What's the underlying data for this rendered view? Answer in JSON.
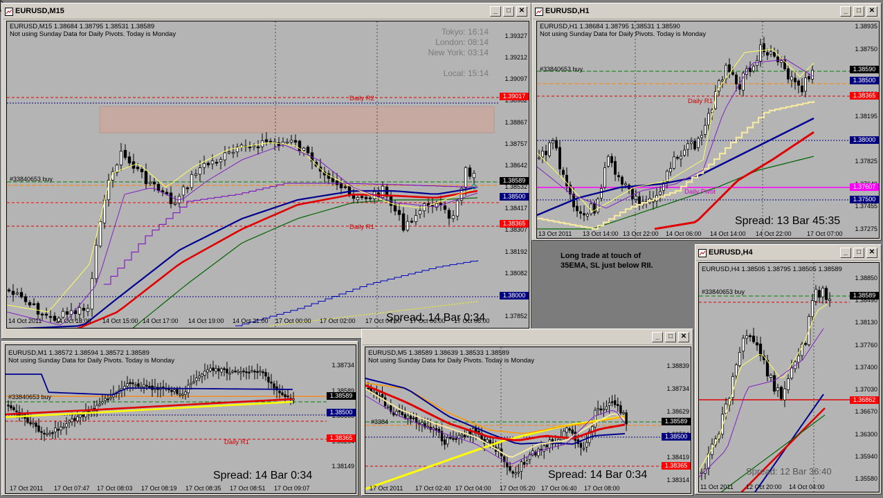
{
  "windows": {
    "m15": {
      "title": "EURUSD,M15",
      "ohlc": "EURUSD,M15  1.38684 1.38795 1.38531 1.38589",
      "note": "Not using Sunday Data for Daily Pivots.  Today is Monday",
      "clocks": [
        "Tokyo: 16:14",
        "London: 08:14",
        "New York: 03:14",
        "Local: 15:14"
      ],
      "price_ticks": [
        "1.39327",
        "1.39212",
        "1.39097",
        "1.38982",
        "1.38867",
        "1.38757",
        "1.38642",
        "1.38532",
        "1.38417",
        "1.38307",
        "1.38192",
        "1.38082",
        "1.37967",
        "1.37852"
      ],
      "tags": [
        {
          "value": "1.39017",
          "color": "#ff0000"
        },
        {
          "value": "1.38589",
          "color": "#000000"
        },
        {
          "value": "1.38500",
          "color": "#000080"
        },
        {
          "value": "1.38365",
          "color": "#ff0000"
        },
        {
          "value": "1.38000",
          "color": "#000080"
        }
      ],
      "time_labels": [
        "14 Oct 2011",
        "14 Oct 13:00",
        "14 Oct 15:00",
        "14 Oct 17:00",
        "14 Oct 19:00",
        "14 Oct 21:00",
        "17 Oct 00:00",
        "17 Oct 02:00",
        "17 Oct 04:00",
        "17 Oct 06:00",
        "17 Oct 08:00"
      ],
      "levels": [
        "Daily R2",
        "Daily R1"
      ],
      "trade_label": "#33840653 buy",
      "spread": "Spread: 14  Bar 0:34"
    },
    "h1": {
      "title": "EURUSD,H1",
      "ohlc": "EURUSD,H1  1.38684 1.38795 1.38531 1.38590",
      "note": "Not using Sunday Data for Daily Pivots.  Today is Monday",
      "price_ticks": [
        "1.38935",
        "1.38750",
        "1.38565",
        "1.38380",
        "1.38195",
        "1.38010",
        "1.37825",
        "1.37640",
        "1.37455",
        "1.37275"
      ],
      "tags": [
        {
          "value": "1.38590",
          "color": "#000000"
        },
        {
          "value": "1.38500",
          "color": "#000080"
        },
        {
          "value": "1.38365",
          "color": "#ff0000"
        },
        {
          "value": "1.38000",
          "color": "#000080"
        },
        {
          "value": "1.37607",
          "color": "#ff00ff"
        },
        {
          "value": "1.37500",
          "color": "#000080"
        }
      ],
      "time_labels": [
        "13 Oct 2011",
        "13 Oct 14:00",
        "13 Oct 22:00",
        "14 Oct 06:00",
        "14 Oct 14:00",
        "14 Oct 22:00",
        "17 Oct 07:00"
      ],
      "levels": [
        "Daily R1",
        "Daily Pivot"
      ],
      "trade_label": "#33840653 buy",
      "spread": "Spread: 13 Bar  45:35"
    },
    "h4": {
      "title": "EURUSD,H4",
      "ohlc": "EURUSD,H4  1.38505 1.38795 1.38505 1.38589",
      "price_ticks": [
        "1.38850",
        "1.38490",
        "1.38130",
        "1.37760",
        "1.37400",
        "1.37030",
        "1.36670",
        "1.36300",
        "1.35940",
        "1.35580"
      ],
      "tags": [
        {
          "value": "1.38589",
          "color": "#000000"
        },
        {
          "value": "1.36862",
          "color": "#ff0000"
        }
      ],
      "time_labels": [
        "11 Oct 2011",
        "12 Oct 20:00",
        "14 Oct 04:00"
      ],
      "trade_label": "#33840653 buy",
      "spread": "Spread: 12 Bar  36:40"
    },
    "m1": {
      "title": "",
      "ohlc": "EURUSD,M1  1.38572 1.38594 1.38572 1.38589",
      "note": "Not using Sunday Data for Daily Pivots.  Today is Monday",
      "price_ticks": [
        "1.38734",
        "1.38589",
        "1.38365",
        "1.38264",
        "1.38149"
      ],
      "tags": [
        {
          "value": "1.38589",
          "color": "#000000"
        },
        {
          "value": "1.38500",
          "color": "#000080"
        },
        {
          "value": "1.38365",
          "color": "#ff0000"
        }
      ],
      "time_labels": [
        "17 Oct 2011",
        "17 Oct 07:47",
        "17 Oct 08:03",
        "17 Oct 08:19",
        "17 Oct 08:35",
        "17 Oct 08:51",
        "17 Oct 09:07"
      ],
      "levels": [
        "Daily R1"
      ],
      "trade_label": "#33840653 buy",
      "spread": "Spread: 14  Bar 0:34"
    },
    "m5": {
      "title": "",
      "ohlc": "EURUSD,M5  1.38589 1.38639 1.38533 1.38589",
      "note": "Not using Sunday Data for Daily Pivots.  Today is Monday",
      "price_ticks": [
        "1.38839",
        "1.38734",
        "1.38629",
        "1.38524",
        "1.38419",
        "1.38314"
      ],
      "tags": [
        {
          "value": "1.38589",
          "color": "#000000"
        },
        {
          "value": "1.38500",
          "color": "#000080"
        },
        {
          "value": "1.38365",
          "color": "#ff0000"
        }
      ],
      "time_labels": [
        "17 Oct 2011",
        "17 Oct 02:40",
        "17 Oct 04:00",
        "17 Oct 05:20",
        "17 Oct 06:40",
        "17 Oct 08:00"
      ],
      "trade_label": "#3384",
      "spread": "Spread: 14  Bar 0:34"
    }
  },
  "annotation": "Long trade at touch of 35EMA, SL just below RII.",
  "buttons": {
    "minimize": "_",
    "maximize": "□",
    "close": "✕"
  }
}
